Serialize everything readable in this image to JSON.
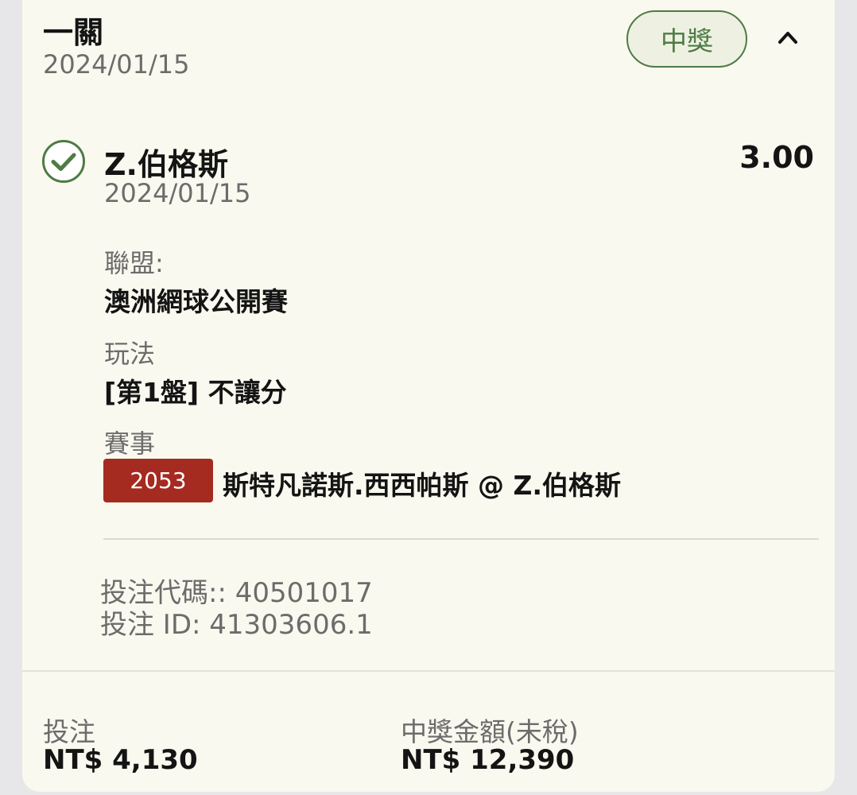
{
  "header": {
    "title": "一關",
    "date": "2024/01/15",
    "status_badge": "中獎",
    "collapse_icon": "chevron-up-icon"
  },
  "selection": {
    "status_icon": "check-circle-icon",
    "status_color": "#4d7b45",
    "name": "Z.伯格斯",
    "date": "2024/01/15",
    "odds": "3.00",
    "league_label": "聯盟:",
    "league_value": "澳洲網球公開賽",
    "market_label": "玩法",
    "market_value": "[第1盤] 不讓分",
    "event_label": "賽事",
    "event_code": "2053",
    "event_code_color": "#a52a20",
    "event_name": "斯特凡諾斯.西西帕斯 @ Z.伯格斯"
  },
  "bet_info": {
    "code_line": "投注代碼:: 40501017",
    "id_line": "投注 ID: 41303606.1"
  },
  "footer": {
    "stake_label": "投注",
    "stake_value": "NT$ 4,130",
    "payout_label": "中獎金額(未稅)",
    "payout_value": "NT$ 12,390"
  }
}
